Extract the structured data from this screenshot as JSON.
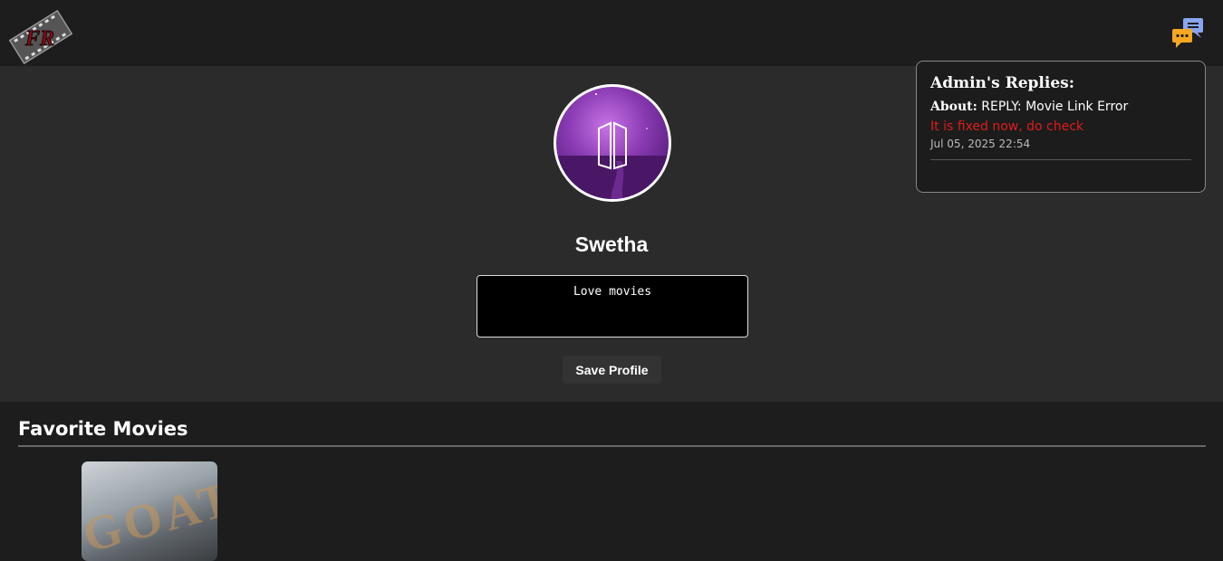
{
  "header": {
    "logo_text": "FR",
    "chat_icon": "chat-bubbles-icon"
  },
  "profile": {
    "username": "Swetha",
    "bio": "Love movies",
    "save_label": "Save Profile"
  },
  "favorites": {
    "title": "Favorite Movies",
    "movies": [
      {
        "poster_text": "GOAT"
      }
    ]
  },
  "replies": {
    "title": "Admin's Replies:",
    "items": [
      {
        "about_label": "About:",
        "about_value": "REPLY: Movie Link Error",
        "message": "It is fixed now, do check",
        "time": "Jul 05, 2025 22:54"
      }
    ]
  },
  "colors": {
    "accent_red": "#e01b1b",
    "chat_orange": "#f5a623",
    "chat_blue": "#8aa6f0"
  }
}
